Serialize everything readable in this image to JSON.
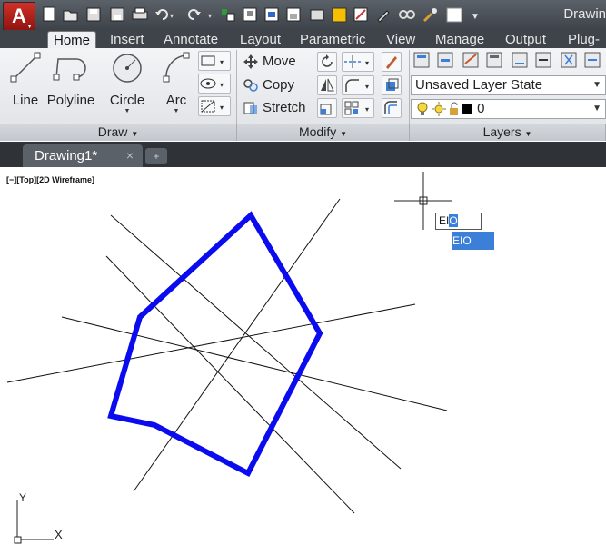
{
  "app": {
    "title": "Drawin",
    "logo_letter": "A"
  },
  "qat": {
    "icons": [
      "new-icon",
      "open-icon",
      "save-icon",
      "saveas-icon",
      "print-icon",
      "undo-icon",
      "redo-icon",
      "match-icon",
      "layout-icon",
      "publish-icon",
      "plot-icon",
      "share-icon",
      "workspace-icon",
      "match-prop-icon",
      "color-swatch"
    ]
  },
  "tabs": [
    "Home",
    "Insert",
    "Annotate",
    "Layout",
    "Parametric",
    "View",
    "Manage",
    "Output",
    "Plug-i"
  ],
  "draw_panel": {
    "title": "Draw",
    "tools": [
      {
        "label": "Line"
      },
      {
        "label": "Polyline"
      },
      {
        "label": "Circle"
      },
      {
        "label": "Arc"
      }
    ]
  },
  "modify_panel": {
    "title": "Modify",
    "items": [
      {
        "label": "Move"
      },
      {
        "label": "Copy"
      },
      {
        "label": "Stretch"
      }
    ]
  },
  "layers_panel": {
    "title": "Layers",
    "layer_state": "Unsaved Layer State",
    "current_layer": "0"
  },
  "file_tab": {
    "name": "Drawing1*",
    "close": "×",
    "new_tab": "+"
  },
  "viewport": {
    "label": "[−][Top][2D Wireframe]"
  },
  "command": {
    "typed_prefix": "EI",
    "typed_selected": "O",
    "suggestion": "EIO"
  },
  "ucs": {
    "x_label": "X",
    "y_label": "Y"
  },
  "colors": {
    "polyline": "#0b0bf0",
    "accent": "#3b7fd8"
  }
}
